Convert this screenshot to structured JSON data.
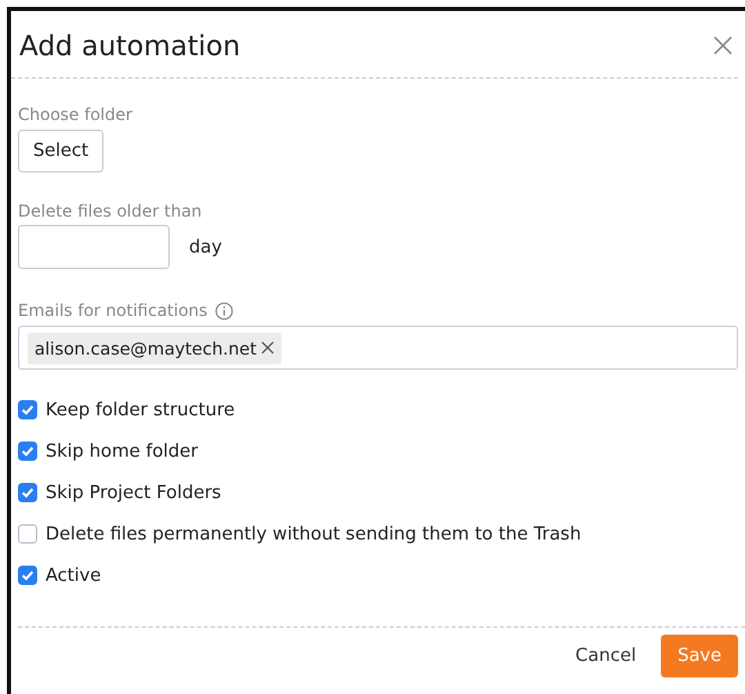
{
  "dialog": {
    "title": "Add automation",
    "choose_folder": {
      "label": "Choose folder",
      "button": "Select"
    },
    "delete_older": {
      "label": "Delete files older than",
      "unit": "day"
    },
    "emails": {
      "label": "Emails for notifications",
      "tags": [
        "alison.case@maytech.net"
      ]
    },
    "options": [
      {
        "label": "Keep folder structure",
        "checked": true
      },
      {
        "label": "Skip home folder",
        "checked": true
      },
      {
        "label": "Skip Project Folders",
        "checked": true
      },
      {
        "label": "Delete files permanently without sending them to the Trash",
        "checked": false
      },
      {
        "label": "Active",
        "checked": true
      }
    ],
    "buttons": [
      {
        "label": "Cancel",
        "kind": "secondary"
      },
      {
        "label": "Save",
        "kind": "primary"
      }
    ]
  }
}
